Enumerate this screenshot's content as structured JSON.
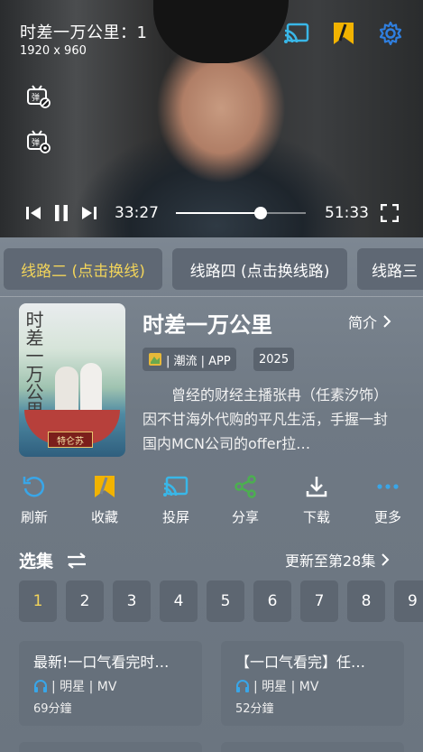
{
  "player": {
    "title": "时差一万公里：1",
    "resolution": "1920 x 960",
    "current_time": "33:27",
    "duration": "51:33",
    "progress": 0.65,
    "icons": [
      "cast-icon",
      "bookmark-icon",
      "settings-icon",
      "danmaku-off-icon",
      "danmaku-settings-icon",
      "skip-previous-icon",
      "pause-icon",
      "skip-next-icon",
      "fullscreen-icon"
    ],
    "accent_color": "#39b7e8",
    "bookmark_color": "#f2b300"
  },
  "routes": [
    {
      "label": "线路二 (点击换线)",
      "active": true
    },
    {
      "label": "线路四 (点击换线路)",
      "active": false
    },
    {
      "label": "线路三",
      "active": false
    }
  ],
  "show": {
    "title": "时差一万公里",
    "intro_label": "简介",
    "tag_category": "| 潮流 | APP",
    "tag_year": "2025",
    "description": "曾经的财经主播张冉（任素汐饰）因不甘海外代购的平凡生活，手握一封国内MCN公司的offer拉…",
    "poster_title": "时差一万公里",
    "poster_badge": "特仑苏"
  },
  "actions": [
    {
      "label": "刷新",
      "icon": "refresh-icon"
    },
    {
      "label": "收藏",
      "icon": "bookmark-icon"
    },
    {
      "label": "投屏",
      "icon": "cast-icon"
    },
    {
      "label": "分享",
      "icon": "share-icon"
    },
    {
      "label": "下载",
      "icon": "download-icon"
    },
    {
      "label": "更多",
      "icon": "more-icon"
    }
  ],
  "episodes": {
    "header": "选集",
    "update_text": "更新至第28集",
    "numbers": [
      "1",
      "2",
      "3",
      "4",
      "5",
      "6",
      "7",
      "8",
      "9"
    ],
    "active": "1"
  },
  "related": [
    {
      "title": "最新!一口气看完时…",
      "meta": "| 明星 | MV",
      "duration": "69分鐘"
    },
    {
      "title": "【一口气看完】任…",
      "meta": "| 明星 | MV",
      "duration": "52分鐘"
    }
  ],
  "colors": {
    "active_text": "#f2d45a",
    "refresh_icon": "#39a6e8",
    "share_icon": "#4caf50"
  }
}
